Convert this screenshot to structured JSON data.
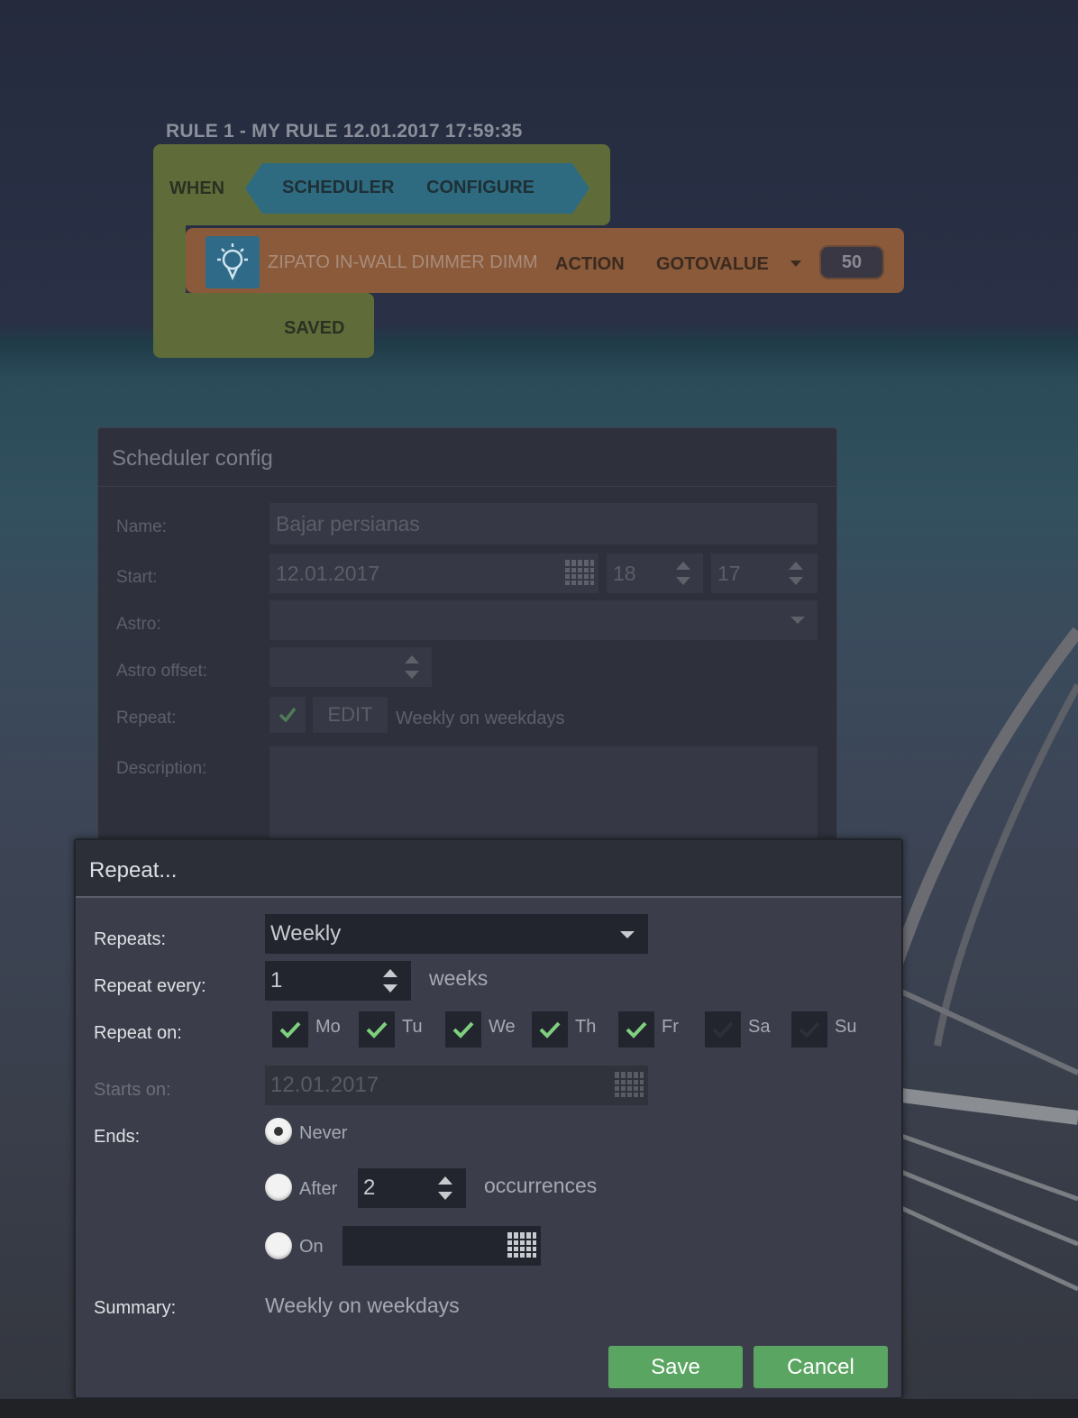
{
  "rule": {
    "title": "RULE 1 - MY RULE 12.01.2017 17:59:35",
    "when_label": "WHEN",
    "trigger_scheduler": "SCHEDULER",
    "trigger_configure": "CONFIGURE",
    "device_name": "ZIPATO IN-WALL DIMMER DIMMER",
    "action_label": "ACTION",
    "action_value": "GOTOVALUE",
    "value": "50",
    "saved_label": "SAVED"
  },
  "scheduler_config": {
    "title": "Scheduler config",
    "name_label": "Name:",
    "name_value": "Bajar persianas",
    "start_label": "Start:",
    "start_date": "12.01.2017",
    "start_hour": "18",
    "start_minute": "17",
    "astro_label": "Astro:",
    "astro_offset_label": "Astro offset:",
    "repeat_label": "Repeat:",
    "edit_label": "EDIT",
    "repeat_summary": "Weekly on weekdays",
    "description_label": "Description:"
  },
  "repeat_dialog": {
    "title": "Repeat...",
    "repeats_label": "Repeats:",
    "repeats_value": "Weekly",
    "repeat_every_label": "Repeat every:",
    "repeat_every_value": "1",
    "repeat_every_unit": "weeks",
    "repeat_on_label": "Repeat on:",
    "days": [
      {
        "label": "Mo",
        "checked": true
      },
      {
        "label": "Tu",
        "checked": true
      },
      {
        "label": "We",
        "checked": true
      },
      {
        "label": "Th",
        "checked": true
      },
      {
        "label": "Fr",
        "checked": true
      },
      {
        "label": "Sa",
        "checked": false
      },
      {
        "label": "Su",
        "checked": false
      }
    ],
    "starts_on_label": "Starts on:",
    "starts_on_value": "12.01.2017",
    "ends_label": "Ends:",
    "ends_never": "Never",
    "ends_after": "After",
    "ends_after_value": "2",
    "ends_after_unit": "occurrences",
    "ends_on": "On",
    "summary_label": "Summary:",
    "summary_value": "Weekly on weekdays",
    "save_label": "Save",
    "cancel_label": "Cancel"
  },
  "colors": {
    "accent_green": "#5ba562",
    "check_green": "#7ed07e"
  }
}
